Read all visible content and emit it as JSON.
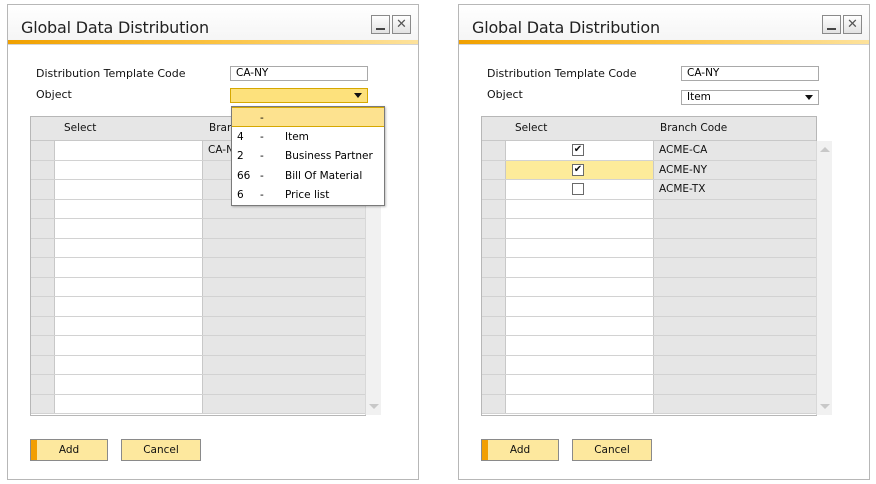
{
  "left": {
    "title": "Global Data Distribution",
    "template_label": "Distribution Template Code",
    "template_value": "CA-NY",
    "object_label": "Object",
    "object_value": "",
    "columns": [
      "Select",
      "Bran"
    ],
    "overlay_text": "CA-NY",
    "dropdown": [
      {
        "code": "",
        "dash": "-",
        "name": ""
      },
      {
        "code": "4",
        "dash": "-",
        "name": "Item"
      },
      {
        "code": "2",
        "dash": "-",
        "name": "Business Partner"
      },
      {
        "code": "66",
        "dash": "-",
        "name": "Bill Of Material"
      },
      {
        "code": "6",
        "dash": "-",
        "name": "Price list"
      }
    ],
    "add_label": "Add",
    "cancel_label": "Cancel"
  },
  "right": {
    "title": "Global Data Distribution",
    "template_label": "Distribution Template Code",
    "template_value": "CA-NY",
    "object_label": "Object",
    "object_value": "Item",
    "columns": [
      "Select",
      "Branch Code"
    ],
    "rows": [
      {
        "checked": true,
        "branch": "ACME-CA"
      },
      {
        "checked": true,
        "branch": "ACME-NY"
      },
      {
        "checked": false,
        "branch": "ACME-TX"
      }
    ],
    "add_label": "Add",
    "cancel_label": "Cancel"
  },
  "colors": {
    "accent": "#f29f00",
    "highlight": "#fdeb9a",
    "button": "#fde89e"
  },
  "icons": {
    "minimize": "minimize-icon",
    "close": "close-icon",
    "check": "checkmark-icon"
  }
}
